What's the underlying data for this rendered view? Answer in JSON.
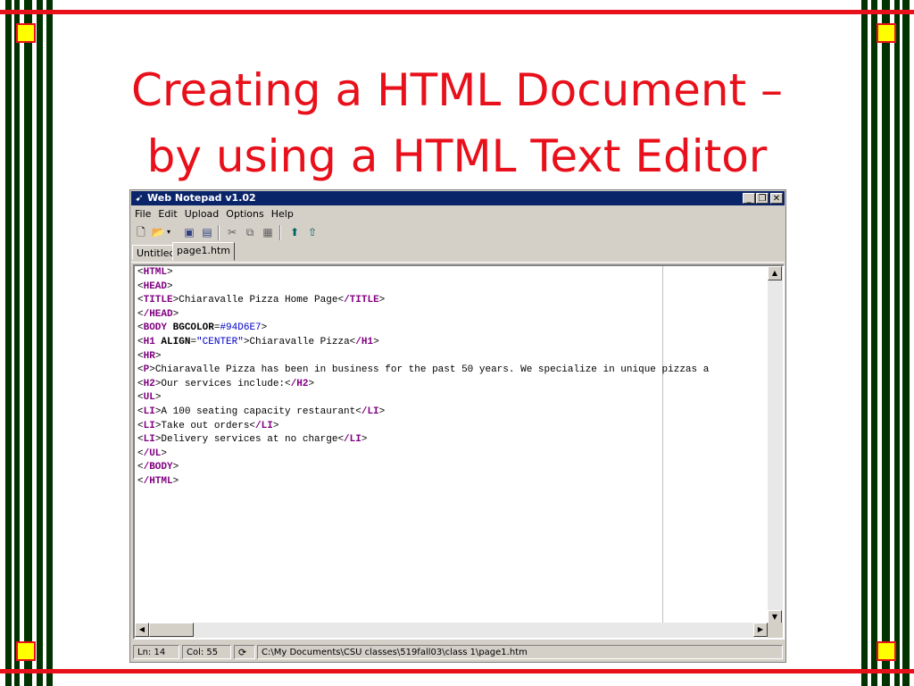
{
  "slide": {
    "title_line1": "Creating a HTML Document –",
    "title_line2": "by using a HTML Text Editor",
    "colors": {
      "accent": "#e8101a",
      "stripe_dark": "#003300",
      "corner": "#ffff00"
    }
  },
  "window": {
    "title": "Web Notepad v1.02",
    "icon": "notepad-icon",
    "controls": {
      "minimize": "_",
      "restore": "❐",
      "close": "✕"
    }
  },
  "menu": [
    {
      "label": "File"
    },
    {
      "label": "Edit"
    },
    {
      "label": "Upload"
    },
    {
      "label": "Options"
    },
    {
      "label": "Help"
    }
  ],
  "toolbar": {
    "icons": [
      "new-file-icon",
      "open-folder-icon",
      "dropdown-arrow-icon",
      "save-icon",
      "save-all-icon",
      "cut-icon",
      "copy-icon",
      "paste-icon",
      "upload-icon",
      "upload-all-icon"
    ]
  },
  "tabs": [
    {
      "label": "Untitled"
    },
    {
      "label": "page1.htm"
    }
  ],
  "editor": {
    "lines": [
      "<HTML>",
      "<HEAD>",
      "<TITLE>Chiaravalle Pizza Home Page</TITLE>",
      "</HEAD>",
      "<BODY BGCOLOR=#94D6E7>",
      "<H1 ALIGN=\"CENTER\">Chiaravalle Pizza</H1>",
      "<HR>",
      "<P>Chiaravalle Pizza has been in business for the past 50 years. We specialize in unique pizzas a",
      "<H2>Our services include:</H2>",
      "<UL>",
      "<LI>A 100 seating capacity restaurant</LI>",
      "<LI>Take out orders</LI>",
      "<LI>Delivery services at no charge</LI>",
      "</UL>",
      "</BODY>",
      "</HTML>"
    ]
  },
  "status": {
    "line": "Ln: 14",
    "col": "Col: 55",
    "path": "C:\\My Documents\\CSU classes\\519fall03\\class 1\\page1.htm"
  }
}
